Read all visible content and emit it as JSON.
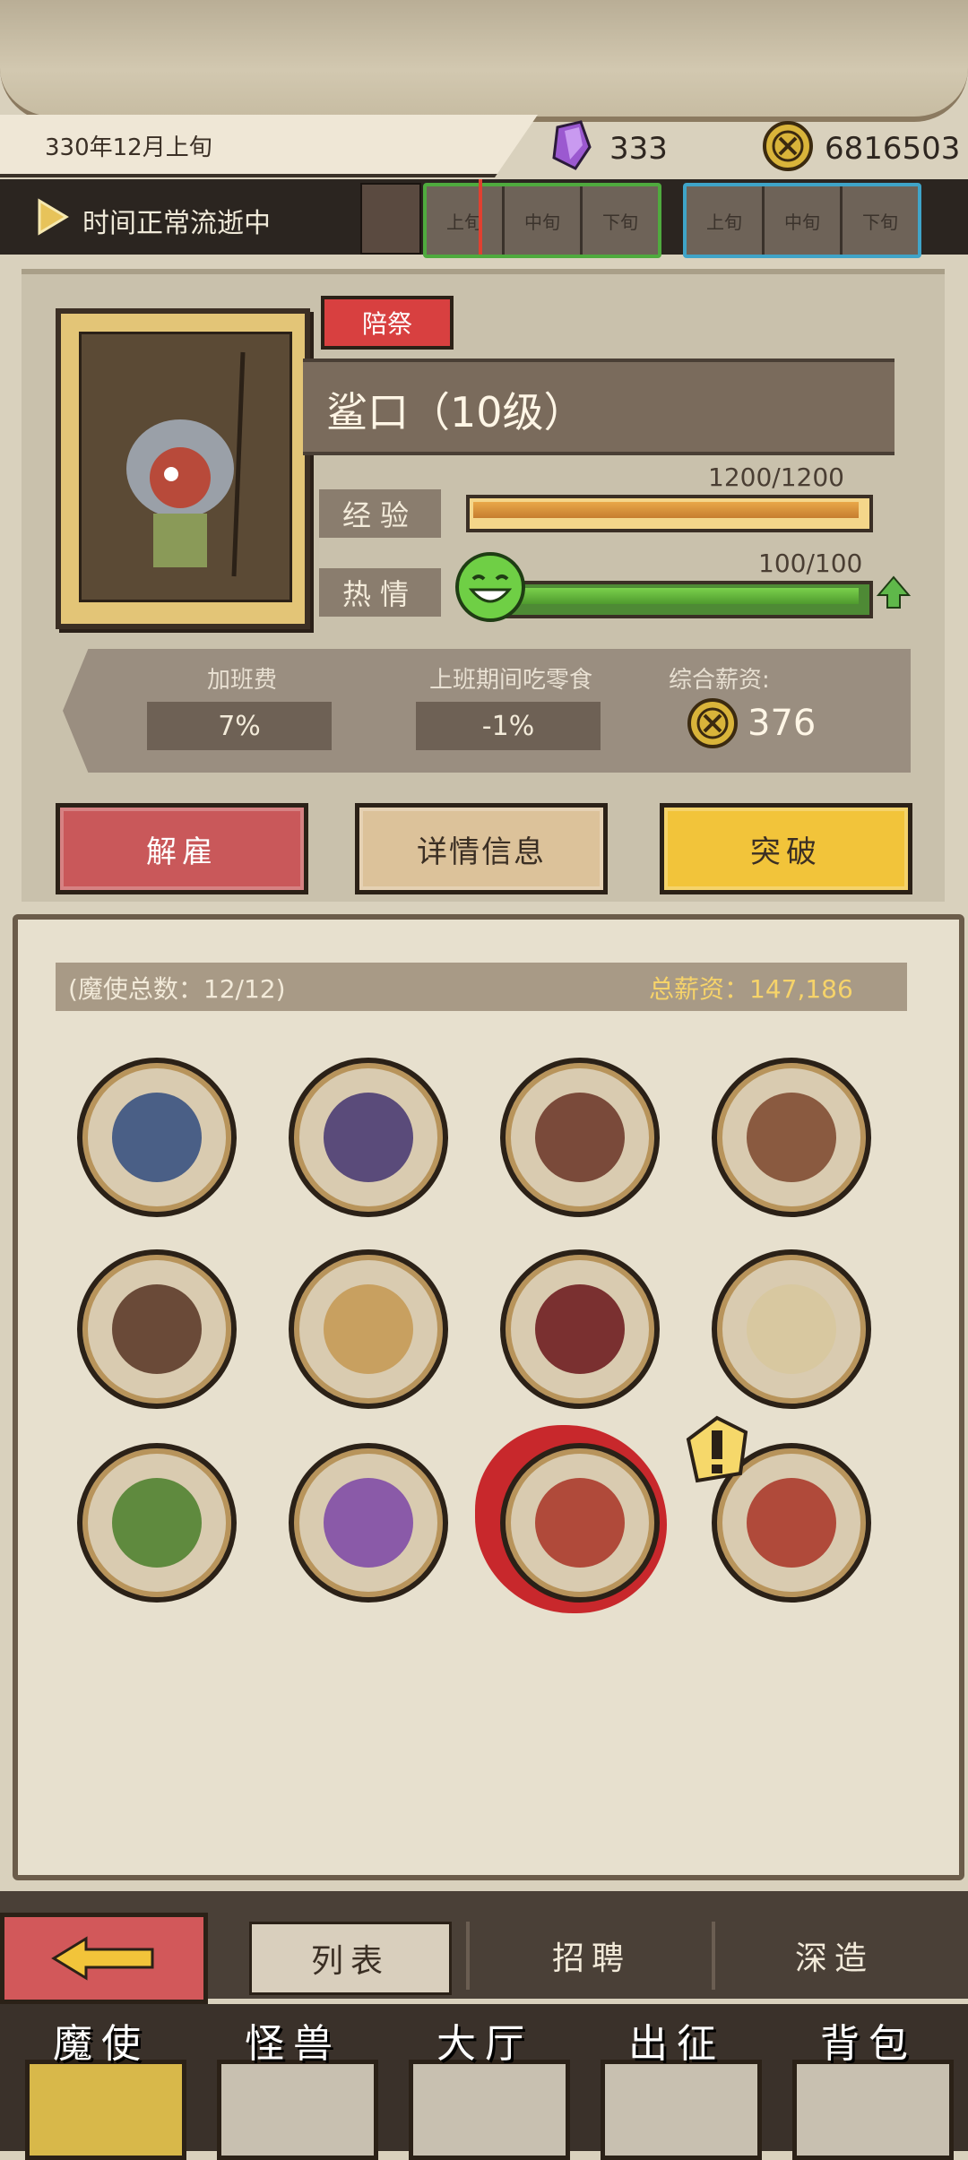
{
  "header": {
    "date": "330年12月上旬",
    "gems": "333",
    "gold": "6816503",
    "gem_icon": "purple-crystal-icon",
    "coin_icon": "gold-coin-icon"
  },
  "time_bar": {
    "status": "时间正常流逝中",
    "periods_current": [
      "上旬",
      "中旬",
      "下旬"
    ],
    "periods_next": [
      "上旬",
      "中旬",
      "下旬"
    ]
  },
  "unit": {
    "tag": "陪祭",
    "name": "鲨口（10级）",
    "exp_label": "经验",
    "exp_value": "1200/1200",
    "exp_ratio": 1.0,
    "passion_label": "热情",
    "passion_value": "100/100",
    "passion_ratio": 1.0
  },
  "wages": {
    "overtime_title": "加班费",
    "overtime_value": "7%",
    "snack_title": "上班期间吃零食",
    "snack_value": "-1%",
    "total_title": "综合薪资:",
    "total_value": "376"
  },
  "actions": {
    "fire": "解雇",
    "detail": "详情信息",
    "breakthrough": "突破"
  },
  "list": {
    "member_count": "(魔使总数：12/12)",
    "total_salary": "总薪资：147,186",
    "avatars": [
      {
        "name": "hooded-mage",
        "color": "#4a5f86"
      },
      {
        "name": "purple-hat-girl",
        "color": "#5a4b7a"
      },
      {
        "name": "checkered-hat-girl",
        "color": "#7a4a3a"
      },
      {
        "name": "white-hair-warrior",
        "color": "#8a5a40"
      },
      {
        "name": "horned-hunter",
        "color": "#6a4a38"
      },
      {
        "name": "witch-girl",
        "color": "#c8a060"
      },
      {
        "name": "red-eye-girl",
        "color": "#7a3030"
      },
      {
        "name": "purple-horn-girl",
        "color": "#d8c8a0"
      },
      {
        "name": "frog-hood-girl",
        "color": "#5f8a3e"
      },
      {
        "name": "purple-hood-girl",
        "color": "#8a5aa8"
      },
      {
        "name": "shark-mouth",
        "color": "#b04a3a"
      },
      {
        "name": "shark-mouth-duplicate",
        "color": "#b04a3a"
      }
    ]
  },
  "subnav": {
    "list": "列表",
    "recruit": "招聘",
    "deepen": "深造"
  },
  "main_nav": [
    "魔使",
    "怪兽",
    "大厅",
    "出征",
    "背包"
  ]
}
